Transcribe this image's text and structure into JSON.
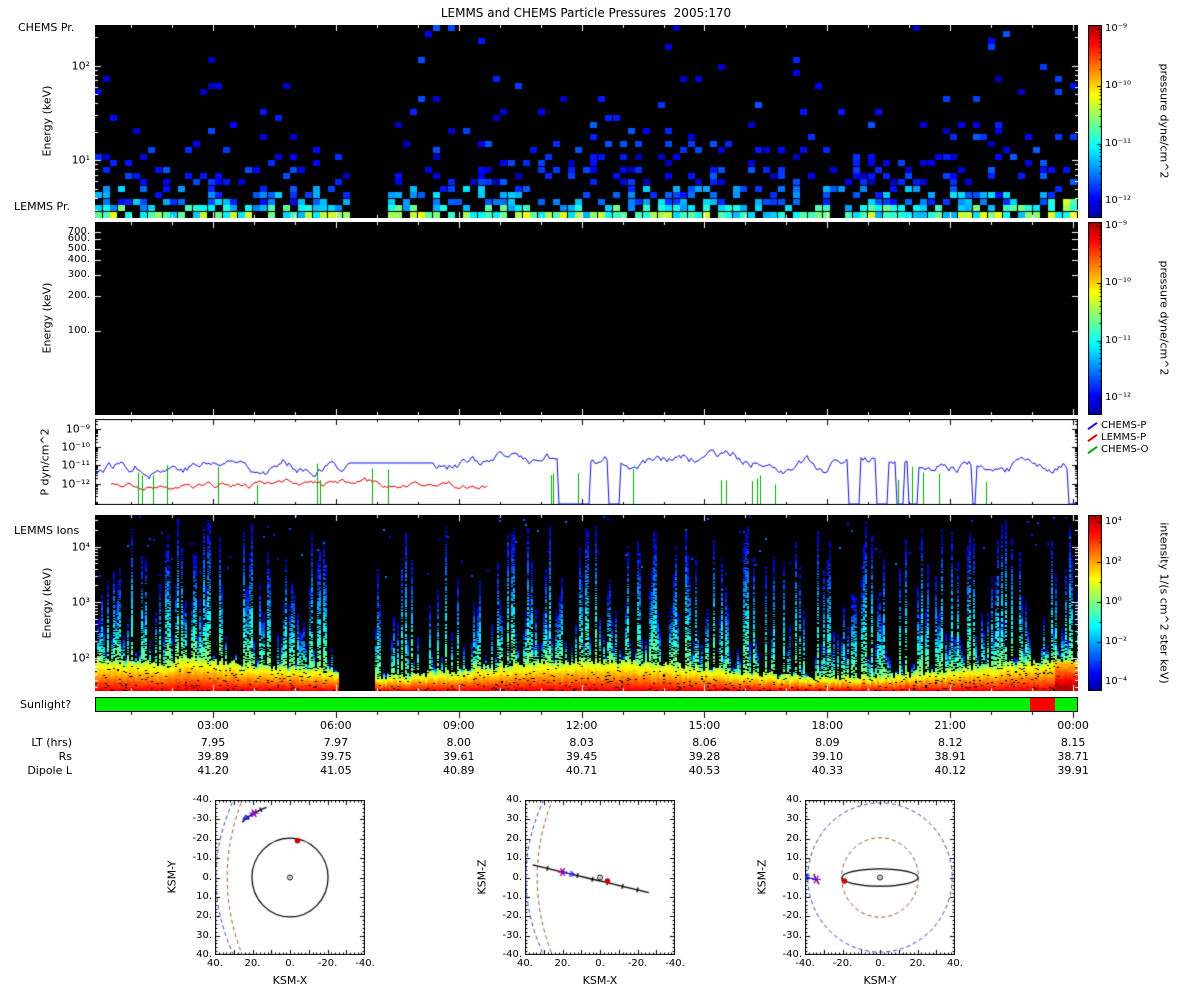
{
  "title": "LEMMS and CHEMS Particle Pressures  2005:170",
  "labels": {
    "chems_pr": "CHEMS Pr.",
    "lemms_pr": "LEMMS Pr.",
    "lemms_ions": "LEMMS Ions",
    "sunlight": "Sunlight?"
  },
  "ylabels": {
    "energy": "Energy (keV)",
    "pdyn": "P dyn/cm^2"
  },
  "colorbars": {
    "pressure": {
      "unit": "pressure dyne/cm^2",
      "log_top": -8.93,
      "log_bot": -12.3,
      "majors": [
        -9,
        -10,
        -11,
        -12
      ],
      "tick_labels": [
        "10⁻⁹",
        "10⁻¹⁰",
        "10⁻¹¹",
        "10⁻¹²"
      ],
      "minor_style": "log"
    },
    "intensity": {
      "unit": "intensity 1/(s cm^2 ster keV)",
      "log_top": 4.35,
      "log_bot": -4.44,
      "majors": [
        4,
        2,
        0,
        -2,
        -4
      ],
      "tick_labels": [
        "10⁴",
        "10²",
        "10⁰",
        "10⁻²",
        "10⁻⁴"
      ],
      "minor_style": "decade"
    }
  },
  "legend": [
    {
      "label": "CHEMS-P",
      "color": "#1111dd"
    },
    {
      "label": "LEMMS-P",
      "color": "#dd0000"
    },
    {
      "label": "CHEMS-O",
      "color": "#00aa00"
    }
  ],
  "time_axis": {
    "start_hour": 0.12,
    "span_hours": 24,
    "major_ticks": [
      3,
      6,
      9,
      12,
      15,
      18,
      21,
      24
    ],
    "labels": [
      "03:00",
      "06:00",
      "09:00",
      "12:00",
      "15:00",
      "18:00",
      "21:00",
      "00:00"
    ]
  },
  "rows": [
    {
      "label": "LT (hrs)",
      "values": [
        "7.95",
        "7.97",
        "8.00",
        "8.03",
        "8.06",
        "8.09",
        "8.12",
        "8.15"
      ]
    },
    {
      "label": "Rs",
      "values": [
        "39.89",
        "39.75",
        "39.61",
        "39.45",
        "39.28",
        "39.10",
        "38.91",
        "38.71"
      ]
    },
    {
      "label": "Dipole L",
      "values": [
        "41.20",
        "41.05",
        "40.89",
        "40.71",
        "40.53",
        "40.33",
        "40.12",
        "39.91"
      ]
    }
  ],
  "sunlight": {
    "label": "Sunlight?",
    "segments": [
      {
        "color": "#00ee00",
        "from": 0,
        "to": 0.952
      },
      {
        "color": "#ff0000",
        "from": 0.952,
        "to": 0.978
      },
      {
        "color": "#00ee00",
        "from": 0.978,
        "to": 1
      }
    ]
  },
  "chart_data": [
    {
      "type": "heatmap",
      "id": "chems-pressure-spectrogram",
      "panel_label": "CHEMS Pr.",
      "x_axis": "time, 2005:170, 00:00-24:00 hrs",
      "y_axis": {
        "label": "Energy (keV)",
        "scale": "log",
        "log_top": 2.429,
        "log_bot": 0.388,
        "majors": [
          1,
          2
        ],
        "labels": [
          "10¹",
          "10²"
        ],
        "minor": true
      },
      "value": {
        "label": "pressure dyne/cm^2",
        "scale": "log",
        "min": 1e-12,
        "max": 1e-09
      },
      "colormap": "jet",
      "data_gap_frac": [
        0.258,
        0.297
      ],
      "grid": {
        "cols": 131,
        "rows": 30
      },
      "seed": 20050170,
      "summary": "sparse scattered cells; occupancy and pressure decrease with energy; mostly blue ~1e-12 cells above 10 keV, green-cyan ~1e-11 cells below ~8 keV, dense green band at lowest energies, bright cluster at right edge, data gap just after 06:00"
    },
    {
      "type": "heatmap",
      "id": "lemms-pressure-spectrogram",
      "panel_label": "LEMMS Pr.",
      "y_axis": {
        "label": "Energy (keV)",
        "scale": "log",
        "log_top": 2.927,
        "log_bot": 1.285,
        "majors": [
          2,
          2.301,
          2.4771,
          2.6021,
          2.699,
          2.7782,
          2.8451
        ],
        "labels": [
          "100.",
          "200.",
          "300.",
          "400.",
          "500.",
          "600.",
          "700."
        ],
        "minor": false
      },
      "value": {
        "label": "pressure dyne/cm^2",
        "scale": "log",
        "min": 1e-12,
        "max": 1e-09
      },
      "seed": 1,
      "summary": "panel entirely black - no pressures above threshold"
    },
    {
      "type": "line",
      "id": "pressure-timeseries",
      "y_axis": {
        "label": "P dyn/cm^2",
        "scale": "log",
        "log_top": -8.43,
        "log_bot": -13.19,
        "majors": [
          -12,
          -11,
          -10,
          -9
        ],
        "labels": [
          "10⁻¹²",
          "10⁻¹¹",
          "10⁻¹⁰",
          "10⁻⁹"
        ],
        "minor": true
      },
      "flat_frac": [
        0.26,
        0.345
      ],
      "seed": 77,
      "series": [
        {
          "name": "CHEMS-P",
          "color": "#1111dd",
          "mean_log": -10.85,
          "range_log": [
            -11.9,
            -10.15
          ],
          "drops_after_frac": 0.45,
          "summary": "irregular line near 1e-11 with frequent narrow dropouts below 1e-12 in the second half of the day"
        },
        {
          "name": "LEMMS-P",
          "color": "#dd0000",
          "mean_log": -12.1,
          "visible_frac": [
            0.015,
            0.4
          ],
          "summary": "low line near 1e-12 visible only before ~10:00"
        },
        {
          "name": "CHEMS-O",
          "color": "#00aa00",
          "spike_count": 26,
          "spike_top_log_range": [
            -12.1,
            -10.9
          ],
          "summary": "isolated vertical spikes rising from below 1e-12"
        }
      ]
    },
    {
      "type": "heatmap",
      "id": "lemms-ion-intensity-spectrogram",
      "panel_label": "LEMMS Ions",
      "y_axis": {
        "label": "Energy (keV)",
        "scale": "log",
        "log_top": 4.57,
        "log_bot": 1.4,
        "majors": [
          2,
          3,
          4
        ],
        "labels": [
          "10²",
          "10³",
          "10⁴"
        ],
        "minor": true
      },
      "value": {
        "label": "intensity 1/(s cm^2 ster keV)",
        "scale": "log",
        "min": 1e-05,
        "max": 10000.0
      },
      "colormap": "jet",
      "data_gap_frac": [
        0.247,
        0.284
      ],
      "seed": 424242,
      "summary": "continuous intense yellow-orange band below ~100 keV; vertical green-blue streaks of decreasing intensity up to 1e4 keV with many black gaps; full-height data gap just after 06:00; enhanced orange patch at right edge"
    },
    {
      "type": "scatter",
      "id": "orbit-ksmx-ksmy",
      "xlabel": "KSM-X",
      "ylabel": "KSM-Y",
      "x_range": [
        40,
        -40
      ],
      "y_range": [
        -40,
        40
      ],
      "x_tick_vals": [
        40,
        20,
        0,
        -20,
        -40
      ],
      "x_tick_labels": [
        "40.",
        "20.",
        "0.",
        "-20.",
        "-40."
      ],
      "y_tick_vals": [
        -40,
        -30,
        -20,
        -10,
        0,
        10,
        20,
        30,
        40
      ],
      "y_tick_labels": [
        "-40.",
        "-30.",
        "-20.",
        "-10.",
        "0.",
        "10.",
        "20.",
        "30.",
        "40."
      ],
      "features": [
        {
          "kind": "dashed-parabola",
          "name": "bow-shock",
          "color": "#3344bb",
          "nose": 39.5,
          "flare": 170
        },
        {
          "kind": "dashed-parabola",
          "name": "magnetopause",
          "color": "#a0522d",
          "nose": 33.5,
          "flare": 200
        },
        {
          "kind": "circle",
          "name": "titan-orbit",
          "r": 20.3,
          "color": "#000000"
        },
        {
          "kind": "saturn",
          "name": "saturn"
        },
        {
          "kind": "dot",
          "name": "titan",
          "pos": [
            -4,
            -19
          ],
          "color": "#cc0000"
        },
        {
          "kind": "trail",
          "name": "cassini-trajectory",
          "ticks": true,
          "pts": [
            [
              25.6,
              -28.5
            ],
            [
              22.5,
              -31.0
            ],
            [
              19.2,
              -33.2
            ],
            [
              15.6,
              -35.0
            ],
            [
              12.5,
              -36.2
            ]
          ]
        },
        {
          "kind": "spacecraft",
          "name": "cassini",
          "pos": [
            19.2,
            -33.2
          ],
          "dir": [
            0.8,
            0.45
          ]
        }
      ]
    },
    {
      "type": "scatter",
      "id": "orbit-ksmx-ksmz",
      "xlabel": "KSM-X",
      "ylabel": "KSM-Z",
      "x_range": [
        40,
        -40
      ],
      "y_range": [
        40,
        -40
      ],
      "x_tick_vals": [
        40,
        20,
        0,
        -20,
        -40
      ],
      "x_tick_labels": [
        "40.",
        "20.",
        "0.",
        "-20.",
        "-40."
      ],
      "y_tick_vals": [
        40,
        30,
        20,
        10,
        0,
        -10,
        -20,
        -30,
        -40
      ],
      "y_tick_labels": [
        "40.",
        "30.",
        "20.",
        "10.",
        "0.",
        "-10.",
        "-20.",
        "-30.",
        "-40."
      ],
      "features": [
        {
          "kind": "dashed-parabola",
          "name": "bow-shock",
          "color": "#3344bb",
          "nose": 39.5,
          "flare": 170
        },
        {
          "kind": "dashed-parabola",
          "name": "magnetopause",
          "color": "#a0522d",
          "nose": 33.5,
          "flare": 200
        },
        {
          "kind": "saturn",
          "name": "saturn"
        },
        {
          "kind": "trail",
          "name": "cassini-trajectory",
          "ticks": true,
          "pts": [
            [
              36,
              6.5
            ],
            [
              28,
              4.7
            ],
            [
              20,
              2.8
            ],
            [
              12,
              1.0
            ],
            [
              4,
              -0.9
            ],
            [
              -4,
              -2.7
            ],
            [
              -12,
              -4.6
            ],
            [
              -20,
              -6.4
            ],
            [
              -26,
              -7.8
            ]
          ]
        },
        {
          "kind": "dot",
          "name": "titan",
          "pos": [
            -4,
            -1.8
          ],
          "color": "#cc0000"
        },
        {
          "kind": "spacecraft",
          "name": "cassini",
          "pos": [
            20,
            2.8
          ],
          "dir": [
            -1,
            -0.23
          ]
        }
      ]
    },
    {
      "type": "scatter",
      "id": "orbit-ksmy-ksmz",
      "xlabel": "KSM-Y",
      "ylabel": "KSM-Z",
      "x_range": [
        -40,
        40
      ],
      "y_range": [
        40,
        -40
      ],
      "x_tick_vals": [
        -40,
        -20,
        0,
        20,
        40
      ],
      "x_tick_labels": [
        "-40.",
        "-20.",
        "0.",
        "20.",
        "40."
      ],
      "y_tick_vals": [
        40,
        30,
        20,
        10,
        0,
        -10,
        -20,
        -30,
        -40
      ],
      "y_tick_labels": [
        "40.",
        "30.",
        "20.",
        "10.",
        "0.",
        "-10.",
        "-20.",
        "-30.",
        "-40."
      ],
      "features": [
        {
          "kind": "dashed-circle",
          "name": "bow-shock",
          "color": "#3344bb",
          "r": 38.5
        },
        {
          "kind": "dashed-circle",
          "name": "magnetopause",
          "color": "#a0522d",
          "r": 20.5
        },
        {
          "kind": "ellipse",
          "name": "titan-orbit",
          "rx": 20.3,
          "rz": 4.5,
          "color": "#000000"
        },
        {
          "kind": "saturn",
          "name": "saturn"
        },
        {
          "kind": "dot",
          "name": "titan",
          "pos": [
            -19,
            -1.8
          ],
          "color": "#cc0000"
        },
        {
          "kind": "trail",
          "name": "cassini-trajectory",
          "ticks": false,
          "pts": [
            [
              -32.5,
              -3.5
            ],
            [
              -34,
              -1
            ],
            [
              -35.3,
              1.8
            ]
          ]
        },
        {
          "kind": "spacecraft",
          "name": "cassini",
          "pos": [
            -34,
            -1
          ],
          "dir": [
            -0.9,
            0.2
          ]
        }
      ]
    }
  ]
}
